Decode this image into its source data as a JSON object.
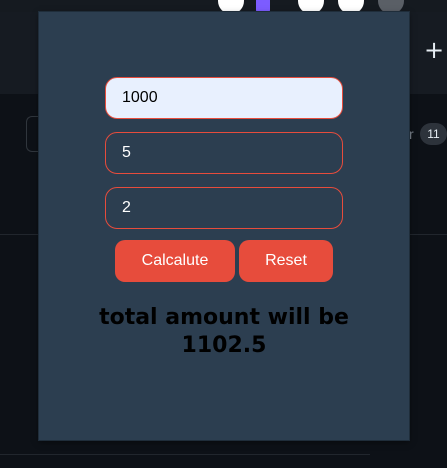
{
  "background": {
    "new_tab_icon": "plus-icon",
    "partial_text": "r",
    "badge_count": "11"
  },
  "calculator": {
    "principal": {
      "value": "1000"
    },
    "rate": {
      "value": "5"
    },
    "time": {
      "value": "2"
    },
    "calculate_label": "Calcalute",
    "reset_label": "Reset",
    "result_line1": "total amount will be",
    "result_line2": "1102.5"
  },
  "colors": {
    "accent": "#e74c3c",
    "panel": "#2c3e50",
    "active_input": "#e8f0fe",
    "page_bg": "#0d1117"
  }
}
